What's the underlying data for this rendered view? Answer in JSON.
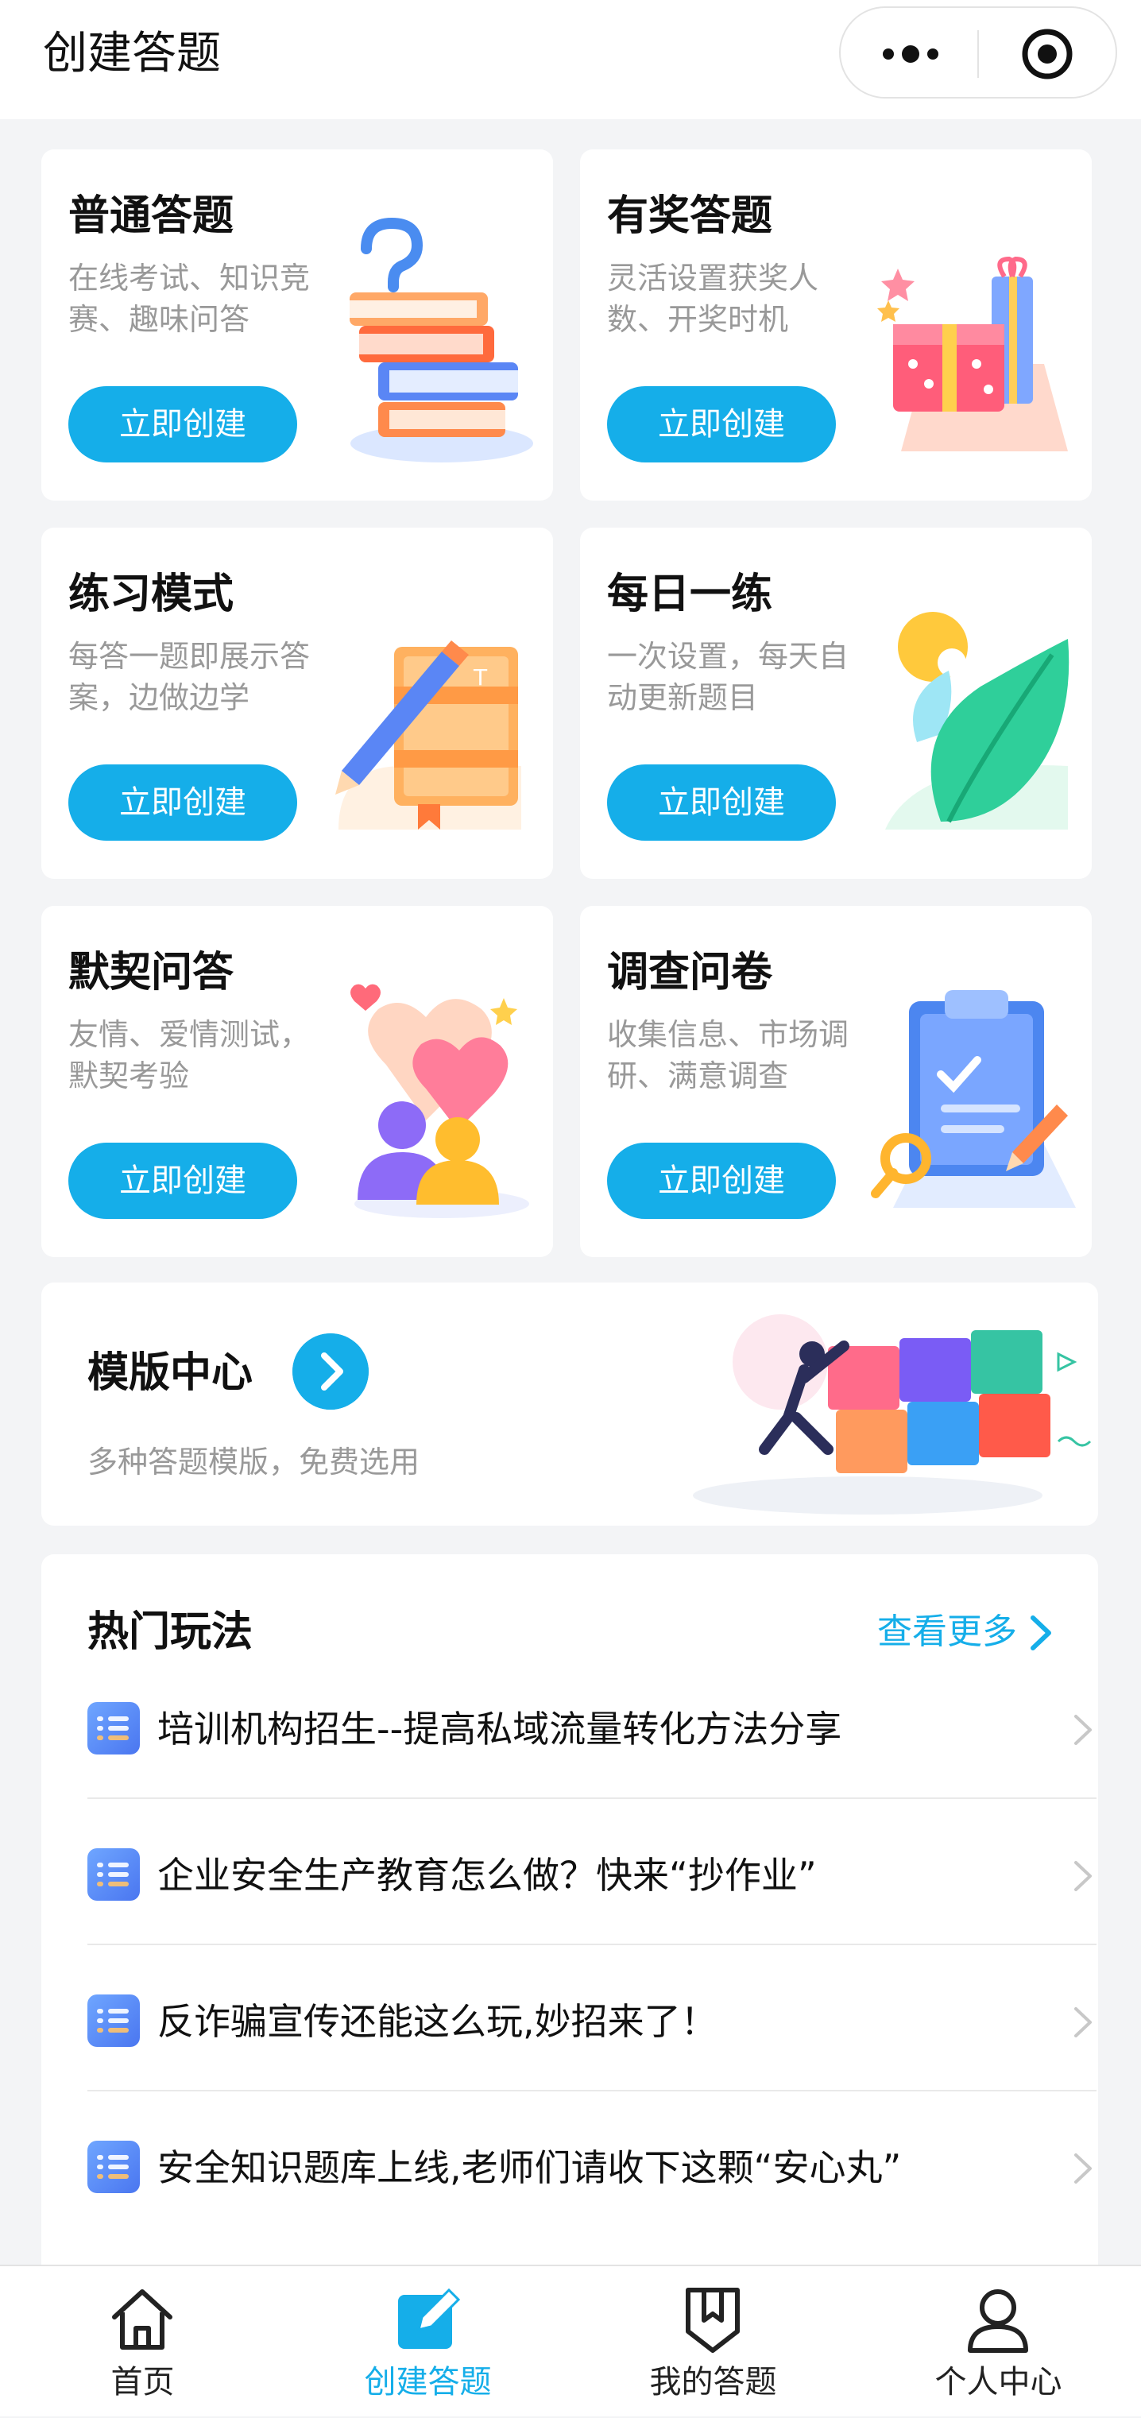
{
  "header": {
    "title": "创建答题"
  },
  "cards": [
    {
      "title": "普通答题",
      "desc": "在线考试、知识竞赛、趣味问答",
      "button": "立即创建",
      "icon": "books-question-icon"
    },
    {
      "title": "有奖答题",
      "desc": "灵活设置获奖人数、开奖时机",
      "button": "立即创建",
      "icon": "gift-box-icon"
    },
    {
      "title": "练习模式",
      "desc": "每答一题即展示答案，边做边学",
      "button": "立即创建",
      "icon": "notebook-pencil-icon"
    },
    {
      "title": "每日一练",
      "desc": "一次设置，每天自动更新题目",
      "button": "立即创建",
      "icon": "leaf-sun-icon"
    },
    {
      "title": "默契问答",
      "desc": "友情、爱情测试，默契考验",
      "button": "立即创建",
      "icon": "hearts-people-icon"
    },
    {
      "title": "调查问卷",
      "desc": "收集信息、市场调研、满意调查",
      "button": "立即创建",
      "icon": "clipboard-survey-icon"
    }
  ],
  "template_center": {
    "title": "模版中心",
    "desc": "多种答题模版，免费选用"
  },
  "hot": {
    "title": "热门玩法",
    "more": "查看更多",
    "items": [
      "培训机构招生--提高私域流量转化方法分享",
      "企业安全生产教育怎么做？快来“抄作业”",
      "反诈骗宣传还能这么玩,妙招来了！",
      "安全知识题库上线,老师们请收下这颗“安心丸”"
    ]
  },
  "tabs": [
    {
      "label": "首页",
      "icon": "home-icon",
      "active": false
    },
    {
      "label": "创建答题",
      "icon": "edit-icon",
      "active": true
    },
    {
      "label": "我的答题",
      "icon": "bookmark-icon",
      "active": false
    },
    {
      "label": "个人中心",
      "icon": "user-icon",
      "active": false
    }
  ],
  "colors": {
    "accent": "#15aee9",
    "background": "#f3f4f6",
    "title": "#111111",
    "muted": "#999999"
  }
}
